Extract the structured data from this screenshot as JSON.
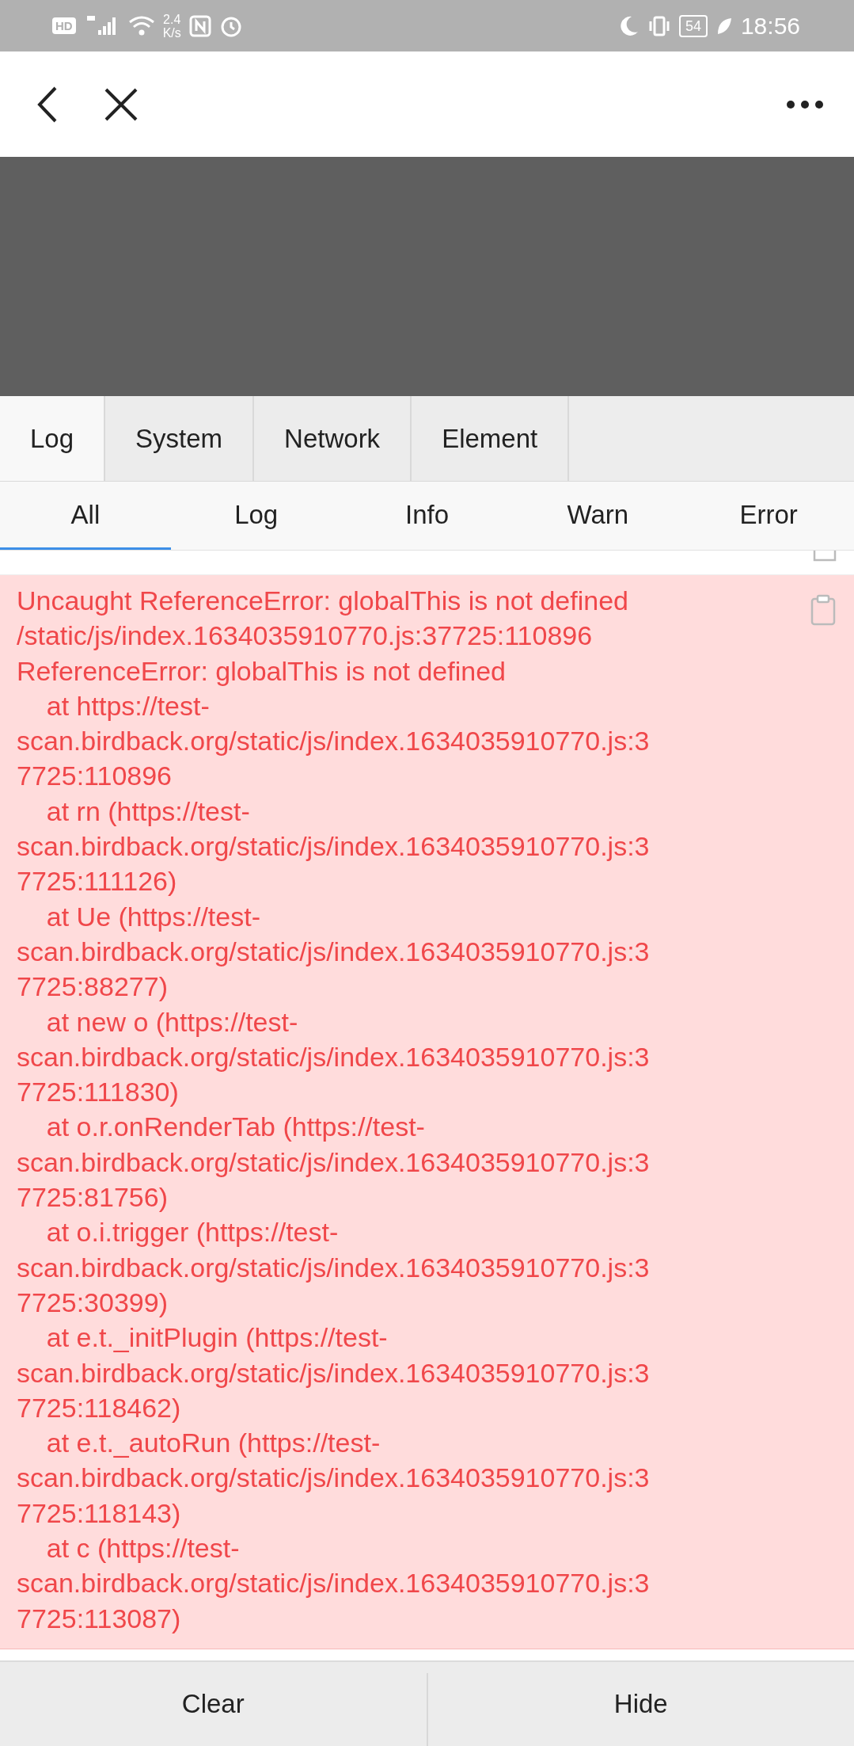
{
  "status_bar": {
    "hd_label": "HD",
    "network_speed_value": "2.4",
    "network_speed_unit": "K/s",
    "battery": "54",
    "time": "18:56"
  },
  "tabs": [
    {
      "label": "Log",
      "selected": true
    },
    {
      "label": "System",
      "selected": false
    },
    {
      "label": "Network",
      "selected": false
    },
    {
      "label": "Element",
      "selected": false
    }
  ],
  "filters": [
    {
      "label": "All",
      "selected": true
    },
    {
      "label": "Log",
      "selected": false
    },
    {
      "label": "Info",
      "selected": false
    },
    {
      "label": "Warn",
      "selected": false
    },
    {
      "label": "Error",
      "selected": false
    }
  ],
  "log_entries": [
    {
      "kind": "error",
      "lines": [
        "Uncaught ReferenceError: globalThis is not defined",
        "/static/js/index.1634035910770.js:37725:110896",
        "ReferenceError: globalThis is not defined",
        "    at https://test-",
        "scan.birdback.org/static/js/index.1634035910770.js:3",
        "7725:110896",
        "    at rn (https://test-",
        "scan.birdback.org/static/js/index.1634035910770.js:3",
        "7725:111126)",
        "    at Ue (https://test-",
        "scan.birdback.org/static/js/index.1634035910770.js:3",
        "7725:88277)",
        "    at new o (https://test-",
        "scan.birdback.org/static/js/index.1634035910770.js:3",
        "7725:111830)",
        "    at o.r.onRenderTab (https://test-",
        "scan.birdback.org/static/js/index.1634035910770.js:3",
        "7725:81756)",
        "    at o.i.trigger (https://test-",
        "scan.birdback.org/static/js/index.1634035910770.js:3",
        "7725:30399)",
        "    at e.t._initPlugin (https://test-",
        "scan.birdback.org/static/js/index.1634035910770.js:3",
        "7725:118462)",
        "    at e.t._autoRun (https://test-",
        "scan.birdback.org/static/js/index.1634035910770.js:3",
        "7725:118143)",
        "    at c (https://test-",
        "scan.birdback.org/static/js/index.1634035910770.js:3",
        "7725:113087)"
      ]
    }
  ],
  "buttons": [
    "Clear",
    "Hide"
  ]
}
